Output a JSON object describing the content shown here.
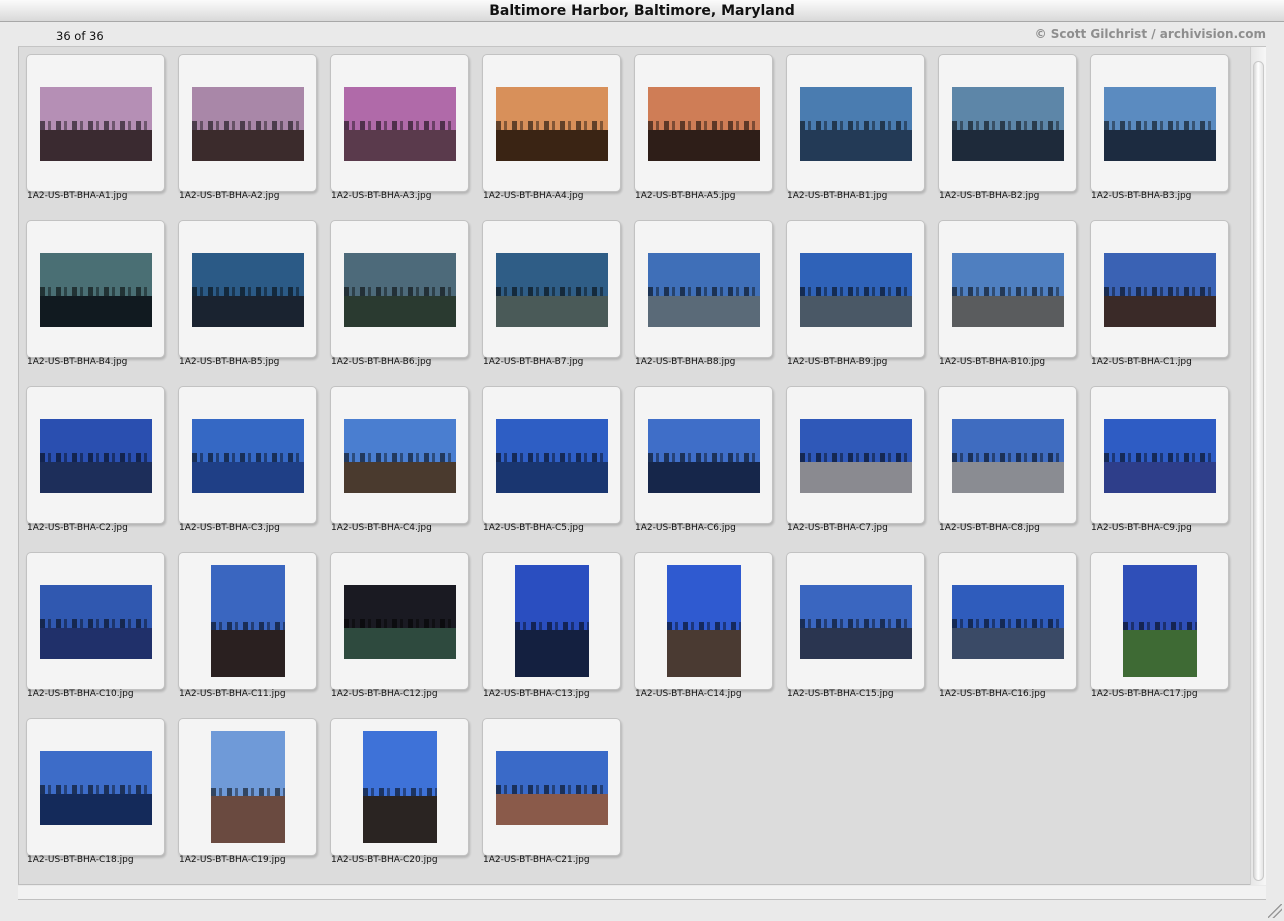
{
  "window": {
    "title": "Baltimore Harbor, Baltimore, Maryland"
  },
  "header": {
    "page_count": "36 of 36",
    "credit": "© Scott Gilchrist / archivision.com"
  },
  "gallery": {
    "items": [
      {
        "filename": "1A2-US-BT-BHA-A1.jpg",
        "orientation": "landscape",
        "sky": "#b58fb5",
        "ground": "#3a2a30"
      },
      {
        "filename": "1A2-US-BT-BHA-A2.jpg",
        "orientation": "landscape",
        "sky": "#a987a8",
        "ground": "#3b2b2c"
      },
      {
        "filename": "1A2-US-BT-BHA-A3.jpg",
        "orientation": "landscape",
        "sky": "#b06aa9",
        "ground": "#5a3a4c"
      },
      {
        "filename": "1A2-US-BT-BHA-A4.jpg",
        "orientation": "landscape",
        "sky": "#d8905a",
        "ground": "#3a2414"
      },
      {
        "filename": "1A2-US-BT-BHA-A5.jpg",
        "orientation": "landscape",
        "sky": "#cf7d56",
        "ground": "#2e1e18"
      },
      {
        "filename": "1A2-US-BT-BHA-B1.jpg",
        "orientation": "landscape",
        "sky": "#4a7cb0",
        "ground": "#233a56"
      },
      {
        "filename": "1A2-US-BT-BHA-B2.jpg",
        "orientation": "landscape",
        "sky": "#5d86a8",
        "ground": "#1e2a3a"
      },
      {
        "filename": "1A2-US-BT-BHA-B3.jpg",
        "orientation": "landscape",
        "sky": "#5b8bc0",
        "ground": "#1c2b40"
      },
      {
        "filename": "1A2-US-BT-BHA-B4.jpg",
        "orientation": "landscape",
        "sky": "#4a6f74",
        "ground": "#111a20"
      },
      {
        "filename": "1A2-US-BT-BHA-B5.jpg",
        "orientation": "landscape",
        "sky": "#2b5a86",
        "ground": "#1a2330"
      },
      {
        "filename": "1A2-US-BT-BHA-B6.jpg",
        "orientation": "landscape",
        "sky": "#4d6a7a",
        "ground": "#2a3a30"
      },
      {
        "filename": "1A2-US-BT-BHA-B7.jpg",
        "orientation": "landscape",
        "sky": "#2f5d86",
        "ground": "#4a5a58"
      },
      {
        "filename": "1A2-US-BT-BHA-B8.jpg",
        "orientation": "landscape",
        "sky": "#3f6fb8",
        "ground": "#5a6a78"
      },
      {
        "filename": "1A2-US-BT-BHA-B9.jpg",
        "orientation": "landscape",
        "sky": "#2f62b8",
        "ground": "#4a5866"
      },
      {
        "filename": "1A2-US-BT-BHA-B10.jpg",
        "orientation": "landscape",
        "sky": "#4f7fc0",
        "ground": "#5a5c5e"
      },
      {
        "filename": "1A2-US-BT-BHA-C1.jpg",
        "orientation": "landscape",
        "sky": "#3a62b4",
        "ground": "#3a2a28"
      },
      {
        "filename": "1A2-US-BT-BHA-C2.jpg",
        "orientation": "landscape",
        "sky": "#2a4fb0",
        "ground": "#1d2e5a"
      },
      {
        "filename": "1A2-US-BT-BHA-C3.jpg",
        "orientation": "landscape",
        "sky": "#3568c4",
        "ground": "#1f3f86"
      },
      {
        "filename": "1A2-US-BT-BHA-C4.jpg",
        "orientation": "landscape",
        "sky": "#4a7ed0",
        "ground": "#4a3a2e"
      },
      {
        "filename": "1A2-US-BT-BHA-C5.jpg",
        "orientation": "landscape",
        "sky": "#2e5ec4",
        "ground": "#1a3670"
      },
      {
        "filename": "1A2-US-BT-BHA-C6.jpg",
        "orientation": "landscape",
        "sky": "#3f6ec8",
        "ground": "#16264a"
      },
      {
        "filename": "1A2-US-BT-BHA-C7.jpg",
        "orientation": "landscape",
        "sky": "#2f58b8",
        "ground": "#8a8a90"
      },
      {
        "filename": "1A2-US-BT-BHA-C8.jpg",
        "orientation": "landscape",
        "sky": "#3f6cc0",
        "ground": "#8a8c92"
      },
      {
        "filename": "1A2-US-BT-BHA-C9.jpg",
        "orientation": "landscape",
        "sky": "#2e5cc4",
        "ground": "#2e3e8a"
      },
      {
        "filename": "1A2-US-BT-BHA-C10.jpg",
        "orientation": "landscape",
        "sky": "#3058b0",
        "ground": "#20306a"
      },
      {
        "filename": "1A2-US-BT-BHA-C11.jpg",
        "orientation": "portrait",
        "sky": "#3a66c0",
        "ground": "#2a2020"
      },
      {
        "filename": "1A2-US-BT-BHA-C12.jpg",
        "orientation": "landscape",
        "sky": "#1a1a22",
        "ground": "#2e4a3e"
      },
      {
        "filename": "1A2-US-BT-BHA-C13.jpg",
        "orientation": "portrait",
        "sky": "#2a4ec0",
        "ground": "#142040"
      },
      {
        "filename": "1A2-US-BT-BHA-C14.jpg",
        "orientation": "portrait",
        "sky": "#2f5ad0",
        "ground": "#4a3a32"
      },
      {
        "filename": "1A2-US-BT-BHA-C15.jpg",
        "orientation": "landscape",
        "sky": "#3a66c0",
        "ground": "#2a3550"
      },
      {
        "filename": "1A2-US-BT-BHA-C16.jpg",
        "orientation": "landscape",
        "sky": "#2f5cbc",
        "ground": "#3a4a66"
      },
      {
        "filename": "1A2-US-BT-BHA-C17.jpg",
        "orientation": "portrait",
        "sky": "#2f4fb8",
        "ground": "#3e6a34"
      },
      {
        "filename": "1A2-US-BT-BHA-C18.jpg",
        "orientation": "landscape",
        "sky": "#3d6cc8",
        "ground": "#142a5a"
      },
      {
        "filename": "1A2-US-BT-BHA-C19.jpg",
        "orientation": "portrait",
        "sky": "#6f9ad8",
        "ground": "#6a4a40"
      },
      {
        "filename": "1A2-US-BT-BHA-C20.jpg",
        "orientation": "portrait",
        "sky": "#3e72d8",
        "ground": "#2a2422"
      },
      {
        "filename": "1A2-US-BT-BHA-C21.jpg",
        "orientation": "landscape",
        "sky": "#3a6ac8",
        "ground": "#8a5a4a"
      }
    ]
  }
}
